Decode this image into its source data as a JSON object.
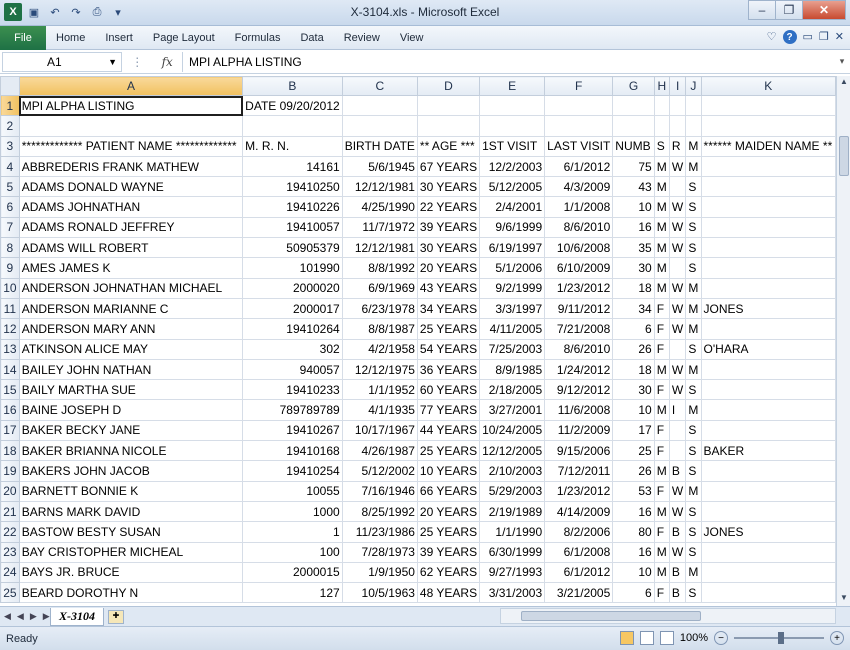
{
  "window": {
    "title": "X-3104.xls  -  Microsoft Excel",
    "min_label": "–",
    "max_label": "❐",
    "close_label": "✕"
  },
  "ribbon": {
    "file_tab": "File",
    "tabs": [
      "Home",
      "Insert",
      "Page Layout",
      "Formulas",
      "Data",
      "Review",
      "View"
    ]
  },
  "formula_bar": {
    "name_box": "A1",
    "fx": "fx",
    "content": "MPI ALPHA LISTING"
  },
  "columns": [
    "A",
    "B",
    "C",
    "D",
    "E",
    "F",
    "G",
    "H",
    "I",
    "J",
    "K"
  ],
  "rows": [
    {
      "n": "1",
      "c": [
        "MPI ALPHA LISTING",
        "DATE 09/20/2012",
        "",
        "",
        "",
        "",
        "",
        "",
        "",
        "",
        ""
      ]
    },
    {
      "n": "2",
      "c": [
        "",
        "",
        "",
        "",
        "",
        "",
        "",
        "",
        "",
        "",
        ""
      ]
    },
    {
      "n": "3",
      "c": [
        "************* PATIENT NAME *************",
        "M. R. N.",
        "BIRTH DATE",
        "** AGE ***",
        "1ST VISIT",
        "LAST VISIT",
        "NUMB",
        "S",
        "R",
        "M",
        "****** MAIDEN NAME **"
      ]
    },
    {
      "n": "4",
      "c": [
        "ABBREDERIS FRANK MATHEW",
        "14161",
        "5/6/1945",
        "67 YEARS",
        "12/2/2003",
        "6/1/2012",
        "75",
        "M",
        "W",
        "M",
        ""
      ]
    },
    {
      "n": "5",
      "c": [
        "ADAMS DONALD WAYNE",
        "19410250",
        "12/12/1981",
        "30 YEARS",
        "5/12/2005",
        "4/3/2009",
        "43",
        "M",
        "",
        "S",
        ""
      ]
    },
    {
      "n": "6",
      "c": [
        "ADAMS JOHNATHAN",
        "19410226",
        "4/25/1990",
        "22 YEARS",
        "2/4/2001",
        "1/1/2008",
        "10",
        "M",
        "W",
        "S",
        ""
      ]
    },
    {
      "n": "7",
      "c": [
        "ADAMS RONALD JEFFREY",
        "19410057",
        "11/7/1972",
        "39 YEARS",
        "9/6/1999",
        "8/6/2010",
        "16",
        "M",
        "W",
        "S",
        ""
      ]
    },
    {
      "n": "8",
      "c": [
        "ADAMS WILL ROBERT",
        "50905379",
        "12/12/1981",
        "30 YEARS",
        "6/19/1997",
        "10/6/2008",
        "35",
        "M",
        "W",
        "S",
        ""
      ]
    },
    {
      "n": "9",
      "c": [
        "AMES JAMES K",
        "101990",
        "8/8/1992",
        "20 YEARS",
        "5/1/2006",
        "6/10/2009",
        "30",
        "M",
        "",
        "S",
        ""
      ]
    },
    {
      "n": "10",
      "c": [
        "ANDERSON JOHNATHAN MICHAEL",
        "2000020",
        "6/9/1969",
        "43 YEARS",
        "9/2/1999",
        "1/23/2012",
        "18",
        "M",
        "W",
        "M",
        ""
      ]
    },
    {
      "n": "11",
      "c": [
        "ANDERSON MARIANNE C",
        "2000017",
        "6/23/1978",
        "34 YEARS",
        "3/3/1997",
        "9/11/2012",
        "34",
        "F",
        "W",
        "M",
        "JONES"
      ]
    },
    {
      "n": "12",
      "c": [
        "ANDERSON MARY ANN",
        "19410264",
        "8/8/1987",
        "25 YEARS",
        "4/11/2005",
        "7/21/2008",
        "6",
        "F",
        "W",
        "M",
        ""
      ]
    },
    {
      "n": "13",
      "c": [
        "ATKINSON ALICE MAY",
        "302",
        "4/2/1958",
        "54 YEARS",
        "7/25/2003",
        "8/6/2010",
        "26",
        "F",
        "",
        "S",
        "O'HARA"
      ]
    },
    {
      "n": "14",
      "c": [
        "BAILEY JOHN NATHAN",
        "940057",
        "12/12/1975",
        "36 YEARS",
        "8/9/1985",
        "1/24/2012",
        "18",
        "M",
        "W",
        "M",
        ""
      ]
    },
    {
      "n": "15",
      "c": [
        "BAILY MARTHA SUE",
        "19410233",
        "1/1/1952",
        "60 YEARS",
        "2/18/2005",
        "9/12/2012",
        "30",
        "F",
        "W",
        "S",
        ""
      ]
    },
    {
      "n": "16",
      "c": [
        "BAINE JOSEPH D",
        "789789789",
        "4/1/1935",
        "77 YEARS",
        "3/27/2001",
        "11/6/2008",
        "10",
        "M",
        "I",
        "M",
        ""
      ]
    },
    {
      "n": "17",
      "c": [
        "BAKER BECKY JANE",
        "19410267",
        "10/17/1967",
        "44 YEARS",
        "10/24/2005",
        "11/2/2009",
        "17",
        "F",
        "",
        "S",
        ""
      ]
    },
    {
      "n": "18",
      "c": [
        "BAKER BRIANNA NICOLE",
        "19410168",
        "4/26/1987",
        "25 YEARS",
        "12/12/2005",
        "9/15/2006",
        "25",
        "F",
        "",
        "S",
        "BAKER"
      ]
    },
    {
      "n": "19",
      "c": [
        "BAKERS JOHN JACOB",
        "19410254",
        "5/12/2002",
        "10 YEARS",
        "2/10/2003",
        "7/12/2011",
        "26",
        "M",
        "B",
        "S",
        ""
      ]
    },
    {
      "n": "20",
      "c": [
        "BARNETT BONNIE K",
        "10055",
        "7/16/1946",
        "66 YEARS",
        "5/29/2003",
        "1/23/2012",
        "53",
        "F",
        "W",
        "M",
        ""
      ]
    },
    {
      "n": "21",
      "c": [
        "BARNS MARK DAVID",
        "1000",
        "8/25/1992",
        "20 YEARS",
        "2/19/1989",
        "4/14/2009",
        "16",
        "M",
        "W",
        "S",
        ""
      ]
    },
    {
      "n": "22",
      "c": [
        "BASTOW BESTY SUSAN",
        "1",
        "11/23/1986",
        "25 YEARS",
        "1/1/1990",
        "8/2/2006",
        "80",
        "F",
        "B",
        "S",
        "JONES"
      ]
    },
    {
      "n": "23",
      "c": [
        "BAY CRISTOPHER MICHEAL",
        "100",
        "7/28/1973",
        "39 YEARS",
        "6/30/1999",
        "6/1/2008",
        "16",
        "M",
        "W",
        "S",
        ""
      ]
    },
    {
      "n": "24",
      "c": [
        "BAYS JR. BRUCE",
        "2000015",
        "1/9/1950",
        "62 YEARS",
        "9/27/1993",
        "6/1/2012",
        "10",
        "M",
        "B",
        "M",
        ""
      ]
    },
    {
      "n": "25",
      "c": [
        "BEARD DOROTHY N",
        "127",
        "10/5/1963",
        "48 YEARS",
        "3/31/2003",
        "3/21/2005",
        "6",
        "F",
        "B",
        "S",
        ""
      ]
    }
  ],
  "sheet": {
    "active_tab": "X-3104"
  },
  "status": {
    "text": "Ready",
    "zoom": "100%",
    "zoom_out": "−",
    "zoom_in": "+"
  },
  "icons": {
    "excel": "excel-logo-icon",
    "save": "save-icon",
    "undo": "undo-icon",
    "help": "help-icon"
  }
}
